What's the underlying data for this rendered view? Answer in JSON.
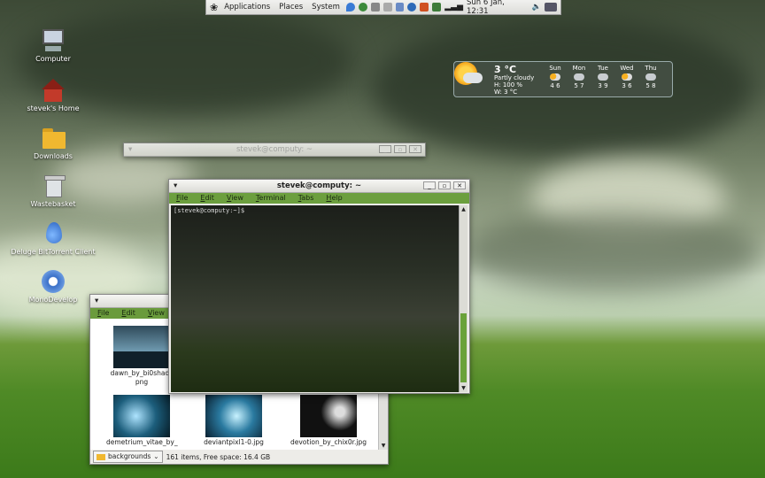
{
  "panel": {
    "menus": [
      "Applications",
      "Places",
      "System"
    ],
    "clock": "Sun  6 Jan, 12:31"
  },
  "desktop_icons": [
    {
      "label": "Computer",
      "icon": "computer-icon"
    },
    {
      "label": "stevek's Home",
      "icon": "home-icon"
    },
    {
      "label": "Downloads",
      "icon": "folder-icon"
    },
    {
      "label": "Wastebasket",
      "icon": "trash-icon"
    },
    {
      "label": "Deluge BitTorrent Client",
      "icon": "deluge-icon"
    },
    {
      "label": "MonoDevelop",
      "icon": "monodevelop-icon"
    }
  ],
  "weather": {
    "temp": "3 °C",
    "condition": "Partly cloudy",
    "humidity": "H: 100 %",
    "wind": "W: 3 °C",
    "forecast": [
      {
        "day": "Sun",
        "range": "4 6"
      },
      {
        "day": "Mon",
        "range": "5 7"
      },
      {
        "day": "Tue",
        "range": "3 9"
      },
      {
        "day": "Wed",
        "range": "3 6"
      },
      {
        "day": "Thu",
        "range": "5 8"
      }
    ]
  },
  "back_window": {
    "title": "stevek@computy: ~"
  },
  "terminal": {
    "title": "stevek@computy: ~",
    "menu": [
      "File",
      "Edit",
      "View",
      "Terminal",
      "Tabs",
      "Help"
    ],
    "prompt": "[stevek@computy:~]$"
  },
  "file_manager": {
    "menu": [
      "File",
      "Edit",
      "View"
    ],
    "files": [
      {
        "name": "dawn_by_bi0shadc",
        "ext": "png"
      },
      {
        "name": "demetrium_vitae_by_",
        "ext": ""
      },
      {
        "name": "deviantpixl1-0.jpg",
        "ext": ""
      },
      {
        "name": "devotion_by_chix0r.jpg",
        "ext": ""
      }
    ],
    "location": "backgrounds",
    "status": "161 items, Free space: 16.4 GB"
  }
}
